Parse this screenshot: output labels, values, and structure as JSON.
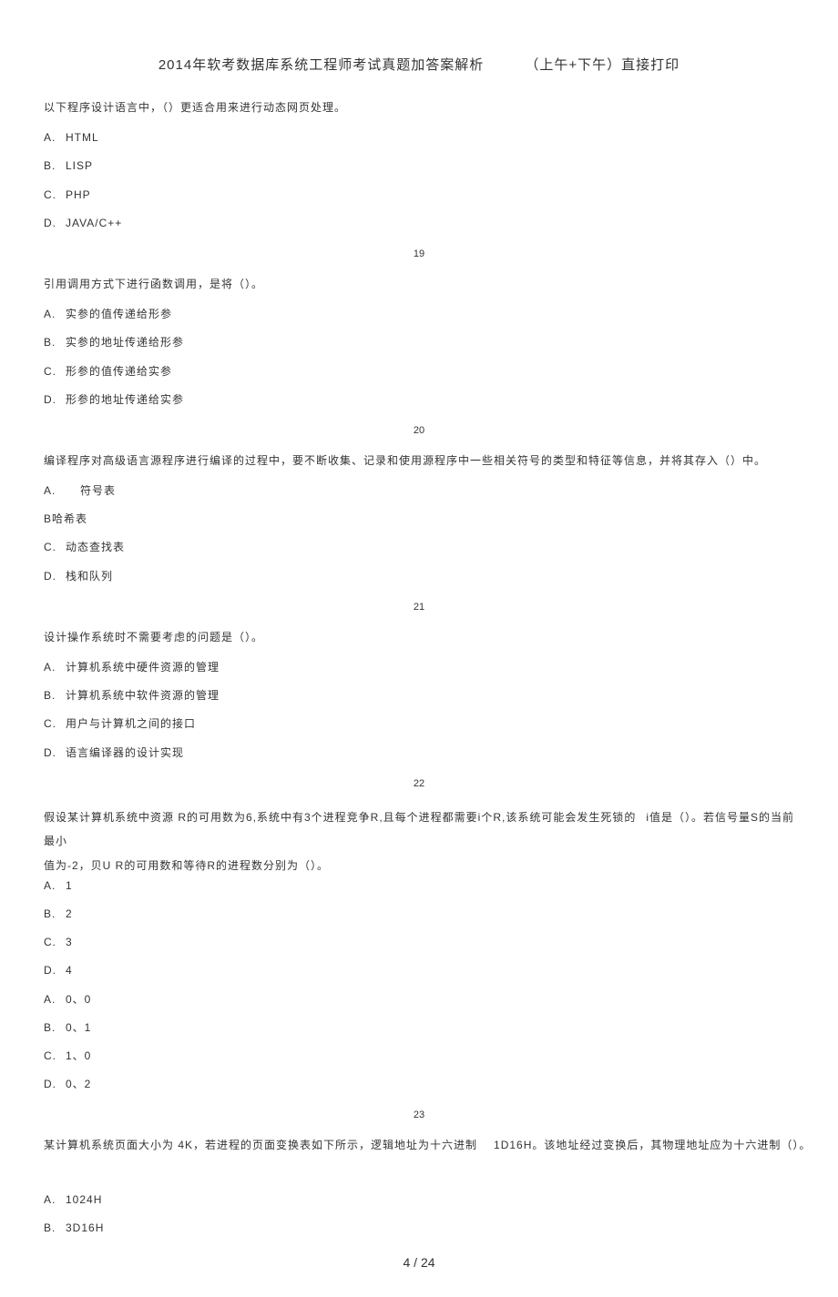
{
  "title": {
    "main": "2014年软考数据库系统工程师考试真题加答案解析",
    "sub": "（上午+下午）直接打印"
  },
  "q18": {
    "stem": "以下程序设计语言中，（）更适合用来进行动态网页处理。",
    "opts": [
      {
        "l": "A.",
        "t": "HTML"
      },
      {
        "l": "B.",
        "t": "LISP"
      },
      {
        "l": "C.",
        "t": "PHP"
      },
      {
        "l": "D.",
        "t": "JAVA/C++"
      }
    ]
  },
  "num19": "19",
  "q19": {
    "stem": "引用调用方式下进行函数调用，是将（）。",
    "opts": [
      {
        "l": "A.",
        "t": "实参的值传递给形参"
      },
      {
        "l": "B.",
        "t": "实参的地址传递给形参"
      },
      {
        "l": "C.",
        "t": "形参的值传递给实参"
      },
      {
        "l": "D.",
        "t": "形参的地址传递给实参"
      }
    ]
  },
  "num20": "20",
  "q20": {
    "stem": "编译程序对高级语言源程序进行编译的过程中，要不断收集、记录和使用源程序中一些相关符号的类型和特征等信息，并将其存入（）中。",
    "optA": {
      "l": "A.",
      "t": "符号表"
    },
    "optB": "B哈希表",
    "optC": {
      "l": "C.",
      "t": "动态查找表"
    },
    "optD": {
      "l": "D.",
      "t": "栈和队列"
    }
  },
  "num21": "21",
  "q21": {
    "stem": "设计操作系统时不需要考虑的问题是（）。",
    "opts": [
      {
        "l": "A.",
        "t": "计算机系统中硬件资源的管理"
      },
      {
        "l": "B.",
        "t": "计算机系统中软件资源的管理"
      },
      {
        "l": "C.",
        "t": "用户与计算机之间的接口"
      },
      {
        "l": "D.",
        "t": "语言编译器的设计实现"
      }
    ]
  },
  "num22": "22",
  "q22": {
    "line1_left": "假设某计算机系统中资源 R的可用数为6,系统中有3个进程竞争R,且每个进程都需要i个R,该系统可能会发生死锁的最小",
    "line1_right": "i值是（）。若信号量S的当前",
    "line2": "值为-2，贝U R的可用数和等待R的进程数分别为（）。",
    "opts1": [
      {
        "l": "A.",
        "t": "1"
      },
      {
        "l": "B.",
        "t": "2"
      },
      {
        "l": "C.",
        "t": "3"
      },
      {
        "l": "D.",
        "t": "4"
      }
    ],
    "opts2": [
      {
        "l": "A.",
        "t": "0、0"
      },
      {
        "l": "B.",
        "t": "0、1"
      },
      {
        "l": "C.",
        "t": "1、0"
      },
      {
        "l": "D.",
        "t": "0、2"
      }
    ]
  },
  "num23": "23",
  "q23": {
    "left": "某计算机系统页面大小为 4K，若进程的页面变换表如下所示，逻辑地址为十六进制",
    "mid": "1D16H。该地址经过变换后，其物理地址应为十六进制（）。",
    "opts": [
      {
        "l": "A.",
        "t": "1024H"
      },
      {
        "l": "B.",
        "t": "3D16H"
      }
    ]
  },
  "footer": "4 / 24"
}
